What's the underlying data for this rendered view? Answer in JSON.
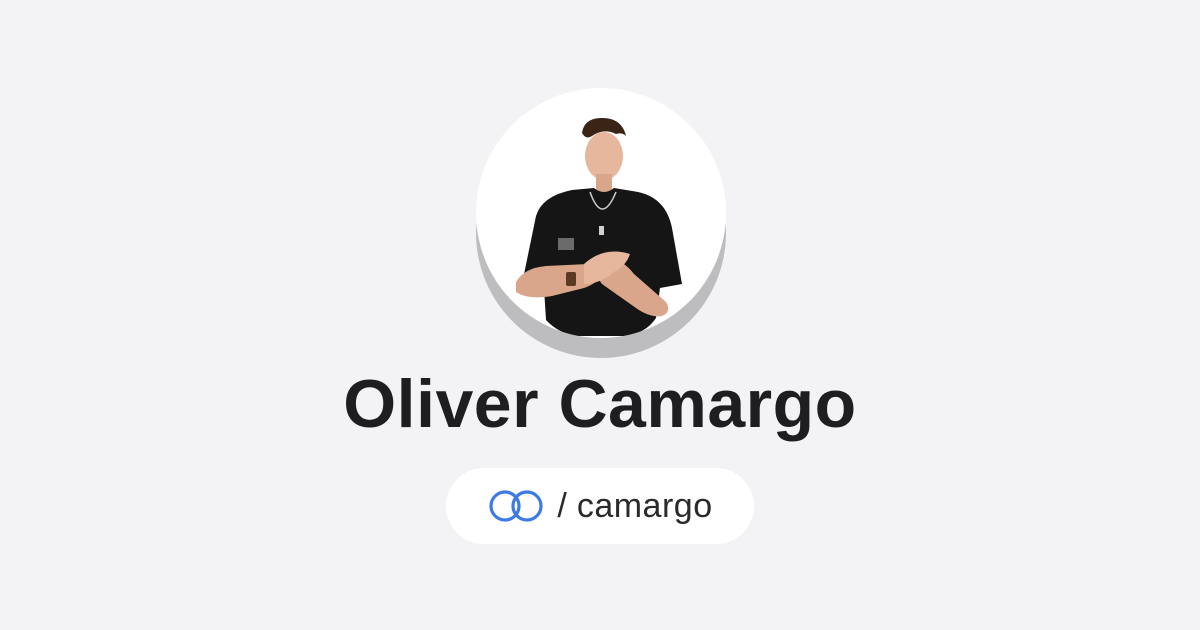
{
  "profile": {
    "name": "Oliver Camargo",
    "handle_prefix": "/",
    "handle": "camargo",
    "avatar_description": "profile-photo"
  },
  "colors": {
    "background": "#f3f3f5",
    "name_text": "#1e1e20",
    "icon_blue": "#3d7ae6",
    "pill_background": "#ffffff",
    "avatar_shadow": "#bdbdbf"
  },
  "icons": {
    "link": "link-rings-icon"
  }
}
